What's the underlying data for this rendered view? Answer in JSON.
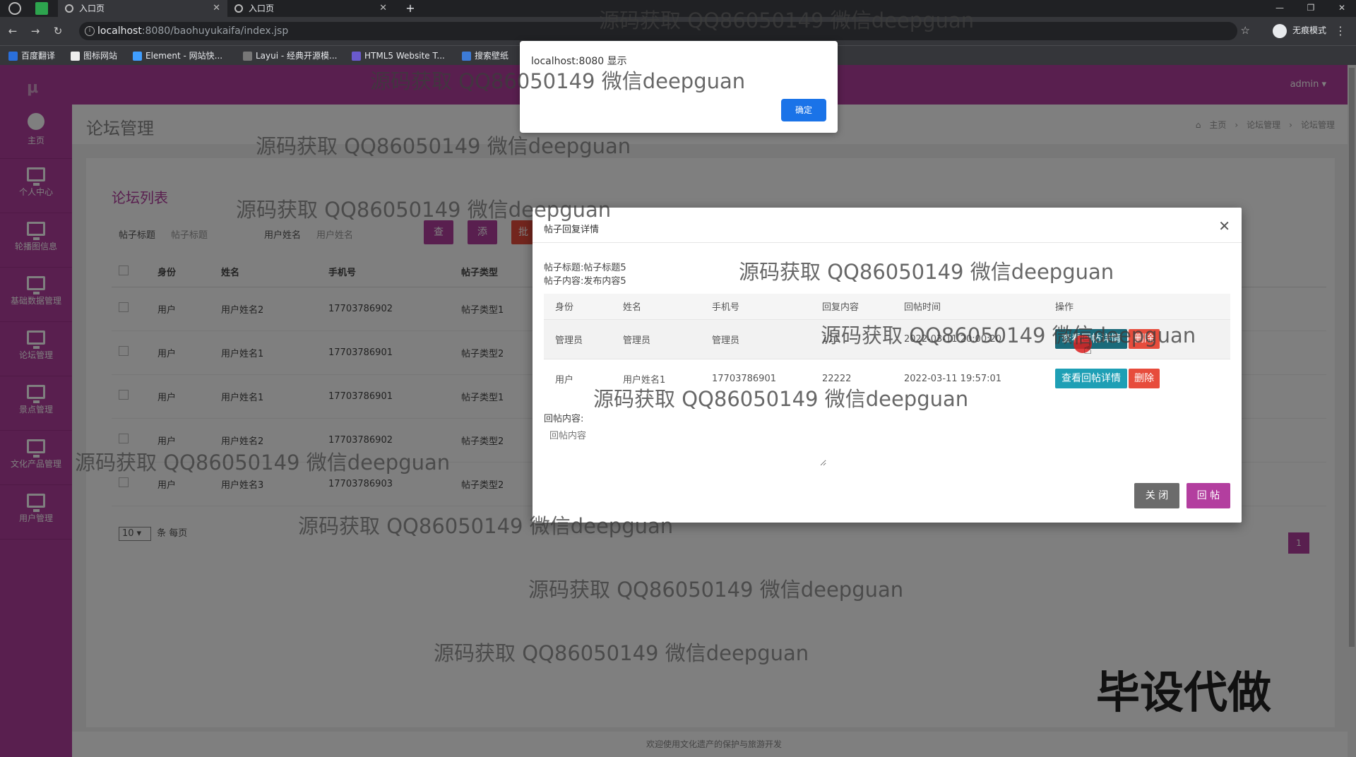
{
  "browser": {
    "tabs": [
      {
        "label": "入口页",
        "active": true
      },
      {
        "label": "入口页",
        "active": false
      }
    ],
    "url_host": "localhost",
    "url_path": ":8080/baohuyukaifa/index.jsp",
    "incognito_label": "无痕模式",
    "bookmarks": [
      "百度翻译",
      "图标网站",
      "Element - 网站快...",
      "Layui - 经典开源模...",
      "HTML5 Website T...",
      "搜索壁纸"
    ]
  },
  "app": {
    "user": "admin",
    "sidebar": [
      {
        "label": "主页"
      },
      {
        "label": "个人中心"
      },
      {
        "label": "轮播图信息"
      },
      {
        "label": "基础数据管理"
      },
      {
        "label": "论坛管理"
      },
      {
        "label": "景点管理"
      },
      {
        "label": "文化产品管理"
      },
      {
        "label": "用户管理"
      }
    ],
    "page_title": "论坛管理",
    "breadcrumb": [
      "主页",
      "论坛管理",
      "论坛管理"
    ],
    "panel_title": "论坛列表",
    "filters": {
      "title_label": "帖子标题",
      "title_placeholder": "帖子标题",
      "name_label": "用户姓名",
      "name_placeholder": "用户姓名",
      "query_button": "查询",
      "add_button": "添加",
      "batch_button": "批"
    },
    "table": {
      "headers": [
        "身份",
        "姓名",
        "手机号",
        "帖子类型"
      ],
      "rows": [
        [
          "用户",
          "用户姓名2",
          "17703786902",
          "帖子类型1"
        ],
        [
          "用户",
          "用户姓名1",
          "17703786901",
          "帖子类型2"
        ],
        [
          "用户",
          "用户姓名1",
          "17703786901",
          "帖子类型1"
        ],
        [
          "用户",
          "用户姓名2",
          "17703786902",
          "帖子类型2"
        ],
        [
          "用户",
          "用户姓名3",
          "17703786903",
          "帖子类型2"
        ]
      ]
    },
    "pager": {
      "page_size": "10",
      "per_page_label": "条 每页",
      "current_page": "1"
    },
    "footer": "欢迎使用文化遗产的保护与旅游开发"
  },
  "modal": {
    "title": "帖子回复详情",
    "post_title": "帖子标题:帖子标题5",
    "post_content": "帖子内容:发布内容5",
    "headers": [
      "身份",
      "姓名",
      "手机号",
      "回复内容",
      "回帖时间",
      "操作"
    ],
    "rows": [
      [
        "管理员",
        "管理员",
        "管理员",
        "111",
        "2022-03-11 20:00:20"
      ],
      [
        "用户",
        "用户姓名1",
        "17703786901",
        "22222",
        "2022-03-11 19:57:01"
      ]
    ],
    "detail_button": "查看回帖详情",
    "delete_button": "删除",
    "reply_label": "回帖内容:",
    "reply_placeholder": "回帖内容",
    "close_button": "关 闭",
    "reply_button": "回 帖"
  },
  "alert": {
    "title": "localhost:8080 显示",
    "ok_button": "确定"
  },
  "watermarks": {
    "text": "源码获取 QQ86050149 微信deepguan",
    "big": "毕设代做"
  }
}
